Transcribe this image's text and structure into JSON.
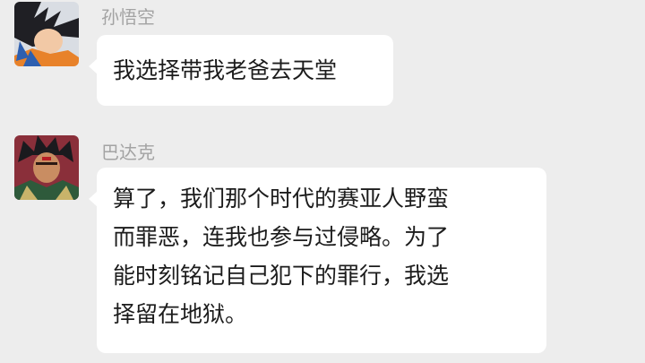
{
  "messages": [
    {
      "sender": "孙悟空",
      "avatar_icon": "goku-avatar",
      "lines": [
        "我选择带我老爸去天堂"
      ]
    },
    {
      "sender": "巴达克",
      "avatar_icon": "bardock-avatar",
      "lines": [
        "算了，我们那个时代的赛亚人野蛮",
        "而罪恶，连我也参与过侵略。为了",
        "能时刻铭记自己犯下的罪行，我选",
        "择留在地狱。"
      ]
    }
  ]
}
